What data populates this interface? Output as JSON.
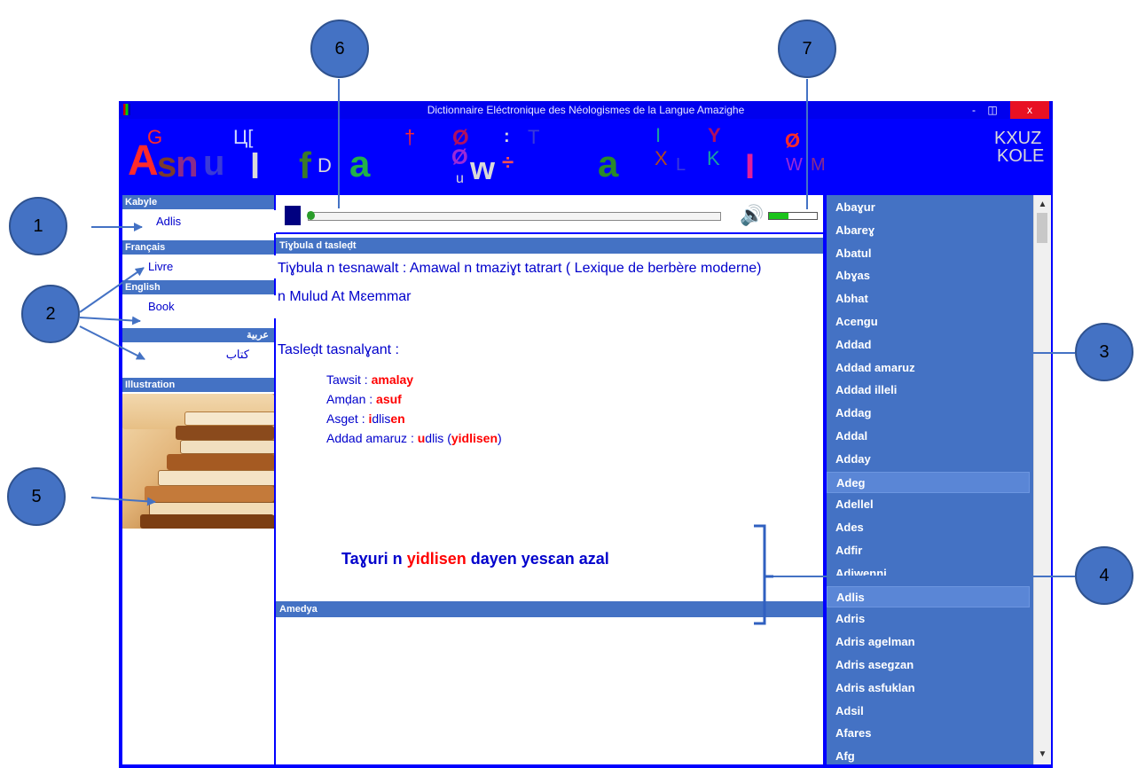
{
  "window": {
    "title": "Dictionnaire Eléctronique des Néologismes de la Langue Amazighe",
    "close_glyph": "x",
    "min_glyph": "-",
    "max_glyph": "◫"
  },
  "callouts": [
    "1",
    "2",
    "3",
    "4",
    "5",
    "6",
    "7"
  ],
  "left": {
    "sections": [
      {
        "header": "Kabyle",
        "value": "Adlis"
      },
      {
        "header": "Français",
        "value": "Livre"
      },
      {
        "header": "English",
        "value": "Book"
      },
      {
        "header": "عربية",
        "value": "كتاب"
      }
    ],
    "illustration_header": "Illustration"
  },
  "center": {
    "player": {
      "volume_icon": "🔊",
      "progress_fraction": 0.0,
      "volume_fraction": 0.4
    },
    "definition_header": "Tiɣbula d tasleḍt",
    "source_line1": "Tiɣbula n tesnawalt : Amawal n tmaziɣt tatrart ( Lexique de berbère moderne)",
    "source_line2": "n Mulud At Mɛemmar",
    "analysis_title": "Tasleḍt tasnalɣant :",
    "rows": [
      {
        "label": "Tawsit : ",
        "value": "amalay"
      },
      {
        "label": "Amḍan : ",
        "value": "asuf"
      },
      {
        "label": "Asget  : ",
        "v1": "i",
        "v2": "dlis",
        "v3": "en"
      },
      {
        "label": "Addad amaruz : ",
        "v1": "u",
        "v2": "dlis (",
        "v3": "yidlisen",
        "v4": ")"
      }
    ],
    "example_header": "Amedya",
    "example": {
      "p1": "Taɣuri n ",
      "p2": "yidlisen",
      "p3": " dayen yesɛan azal"
    }
  },
  "wordlist": [
    "Abaɣur",
    "Abareɣ",
    "Abatul",
    "Abɣas",
    "Abhat",
    "Acengu",
    "Addad",
    "Addad amaruz",
    "Addad illeli",
    "Addag",
    "Addal",
    "Adday",
    "Adeg",
    "Adellel",
    "Ades",
    "Adfir",
    "Adiwenni",
    "Adlis",
    "Adris",
    "Adris agelman",
    "Adris asegzan",
    "Adris asfuklan",
    "Adsil",
    "Afares",
    "Afg"
  ],
  "wordlist_highlighted": [
    "Adeg",
    "Adlis"
  ],
  "colors": {
    "window_blue": "#0000ff",
    "header_blue": "#4472c4",
    "text_blue": "#0000cc",
    "red": "#ff0000",
    "callout": "#4472c4"
  }
}
